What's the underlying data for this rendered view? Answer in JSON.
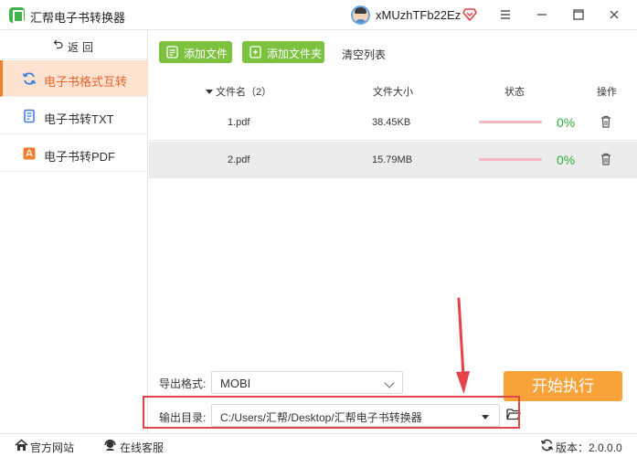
{
  "app": {
    "title": "汇帮电子书转换器",
    "username": "xMUzhTFb22Ez"
  },
  "sidebar": {
    "back_label": "返回",
    "items": [
      {
        "label": "电子书格式互转",
        "active": true,
        "icon": "refresh-icon"
      },
      {
        "label": "电子书转TXT",
        "active": false,
        "icon": "document-icon"
      },
      {
        "label": "电子书转PDF",
        "active": false,
        "icon": "pdf-icon"
      }
    ]
  },
  "toolbar": {
    "add_file_label": "添加文件",
    "add_folder_label": "添加文件夹",
    "clear_label": "清空列表"
  },
  "table": {
    "headers": {
      "name": "文件名（2）",
      "size": "文件大小",
      "status": "状态",
      "action": "操作"
    },
    "rows": [
      {
        "name": "1.pdf",
        "size": "38.45KB",
        "progress": "0%"
      },
      {
        "name": "2.pdf",
        "size": "15.79MB",
        "progress": "0%"
      }
    ]
  },
  "settings": {
    "format_label": "导出格式:",
    "format_value": "MOBI",
    "output_label": "输出目录:",
    "output_value": "C:/Users/汇帮/Desktop/汇帮电子书转换器"
  },
  "start_button_label": "开始执行",
  "statusbar": {
    "website_label": "官方网站",
    "support_label": "在线客服",
    "version_label": "版本：2.0.0.0"
  },
  "colors": {
    "green": "#7cc23f",
    "orange": "#f8a23a",
    "active_bg": "#fde2cf",
    "active_text": "#e8632a",
    "progress_pct": "#2fae3d",
    "highlight_red": "#e5434a"
  }
}
